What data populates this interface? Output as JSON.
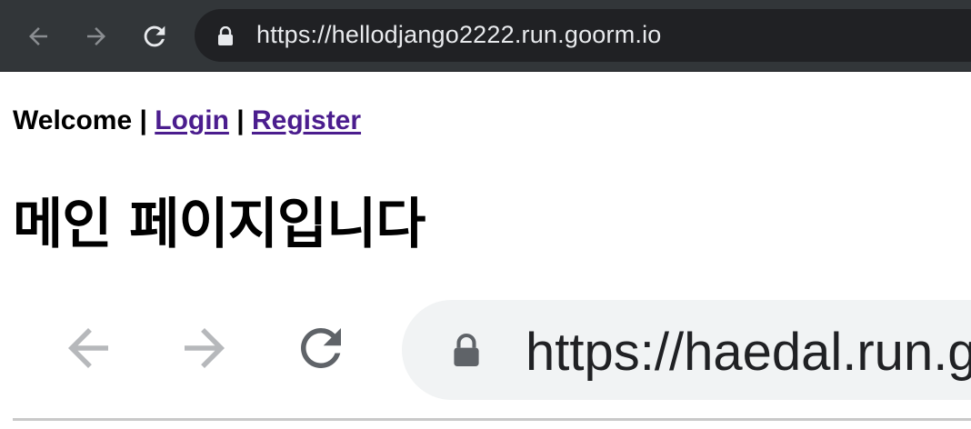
{
  "browser": {
    "url": "https://hellodjango2222.run.goorm.io",
    "back_icon": "arrow-left-icon",
    "forward_icon": "arrow-right-icon",
    "reload_icon": "reload-icon",
    "lock_icon": "lock-icon"
  },
  "page": {
    "welcome_text": "Welcome",
    "separator": "|",
    "login_link": "Login",
    "register_link": "Register",
    "heading": "메인 페이지입니다"
  },
  "embedded_image": {
    "url": "https://haedal.run.g"
  },
  "colors": {
    "toolbar_bg": "#323639",
    "omnibox_bg": "#202124",
    "link_visited": "#4b1d8e",
    "embedded_omnibox_bg": "#f1f3f4"
  }
}
